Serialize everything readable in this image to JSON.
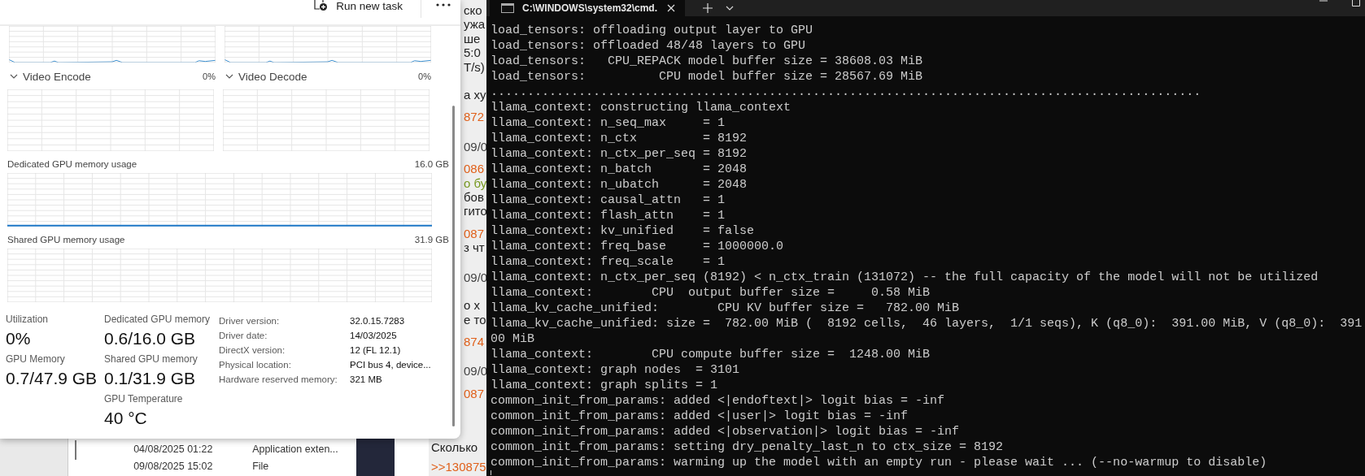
{
  "task_manager": {
    "toolbar": {
      "run_task": "Run new task"
    },
    "engine_graphs": [
      {
        "title": "Video Encode",
        "value": "0%"
      },
      {
        "title": "Video Decode",
        "value": "0%"
      }
    ],
    "memory_graphs": [
      {
        "title": "Dedicated GPU memory usage",
        "max": "16.0 GB",
        "kind": "line"
      },
      {
        "title": "Shared GPU memory usage",
        "max": "31.9 GB",
        "kind": "empty"
      }
    ],
    "stat_columns": [
      [
        {
          "label": "Utilization",
          "value": "0%"
        },
        {
          "label": "GPU Memory",
          "value": "0.7/47.9 GB"
        }
      ],
      [
        {
          "label": "Dedicated GPU memory",
          "value": "0.6/16.0 GB"
        },
        {
          "label": "Shared GPU memory",
          "value": "0.1/31.9 GB"
        },
        {
          "label": "GPU Temperature",
          "value": "40 °C"
        }
      ]
    ],
    "details": [
      {
        "label": "Driver version:",
        "value": "32.0.15.7283"
      },
      {
        "label": "Driver date:",
        "value": "14/03/2025"
      },
      {
        "label": "DirectX version:",
        "value": "12 (FL 12.1)"
      },
      {
        "label": "Physical location:",
        "value": "PCI bus 4, device..."
      },
      {
        "label": "Hardware reserved memory:",
        "value": "321 MB"
      }
    ]
  },
  "background_page": {
    "fragments": [
      {
        "text": "ско",
        "kind": "text"
      },
      {
        "text": "ужа",
        "kind": "text"
      },
      {
        "text": "ше",
        "kind": "text"
      },
      {
        "text": "5:0",
        "kind": "text"
      },
      {
        "text": "T/s)",
        "kind": "text"
      },
      {
        "text": "а ху",
        "kind": "gap"
      },
      {
        "text": "872",
        "kind": "link"
      },
      {
        "text": "09/0",
        "kind": "date"
      },
      {
        "text": "086",
        "kind": "link"
      },
      {
        "text": "о бу",
        "kind": "quote"
      },
      {
        "text": "бов",
        "kind": "text"
      },
      {
        "text": "гито",
        "kind": "text"
      },
      {
        "text": "087",
        "kind": "link"
      },
      {
        "text": "з чт",
        "kind": "text"
      },
      {
        "text": "09/0",
        "kind": "date"
      },
      {
        "text": "о х",
        "kind": "gap"
      },
      {
        "text": "е то",
        "kind": "text"
      },
      {
        "text": "874",
        "kind": "link"
      },
      {
        "text": "09/0",
        "kind": "date"
      },
      {
        "text": "087",
        "kind": "link"
      }
    ],
    "bottom_lines": [
      {
        "text": "Сколько",
        "kind": "text"
      },
      {
        "text": ">>130875",
        "kind": "link"
      }
    ]
  },
  "file_rows": [
    {
      "date": "04/08/2025 01:22",
      "type": "Application exten..."
    },
    {
      "date": "09/08/2025 15:02",
      "type": "File"
    }
  ],
  "terminal": {
    "tab_title": "C:\\WINDOWS\\system32\\cmd.",
    "lines": [
      "load_tensors: offloading output layer to GPU",
      "load_tensors: offloaded 48/48 layers to GPU",
      "load_tensors:   CPU_REPACK model buffer size = 38608.03 MiB",
      "load_tensors:          CPU model buffer size = 28567.69 MiB",
      ".................................................................................................",
      "llama_context: constructing llama_context",
      "llama_context: n_seq_max     = 1",
      "llama_context: n_ctx         = 8192",
      "llama_context: n_ctx_per_seq = 8192",
      "llama_context: n_batch       = 2048",
      "llama_context: n_ubatch      = 2048",
      "llama_context: causal_attn   = 1",
      "llama_context: flash_attn    = 1",
      "llama_context: kv_unified    = false",
      "llama_context: freq_base     = 1000000.0",
      "llama_context: freq_scale    = 1",
      "llama_context: n_ctx_per_seq (8192) < n_ctx_train (131072) -- the full capacity of the model will not be utilized",
      "llama_context:        CPU  output buffer size =     0.58 MiB",
      "llama_kv_cache_unified:        CPU KV buffer size =   782.00 MiB",
      "llama_kv_cache_unified: size =  782.00 MiB (  8192 cells,  46 layers,  1/1 seqs), K (q8_0):  391.00 MiB, V (q8_0):  391",
      "00 MiB",
      "llama_context:        CPU compute buffer size =  1248.00 MiB",
      "llama_context: graph nodes  = 3101",
      "llama_context: graph splits = 1",
      "common_init_from_params: added <|endoftext|> logit bias = -inf",
      "common_init_from_params: added <|user|> logit bias = -inf",
      "common_init_from_params: added <|observation|> logit bias = -inf",
      "common_init_from_params: setting dry_penalty_last_n to ctx_size = 8192",
      "common_init_from_params: warming up the model with an empty run - please wait ... (--no-warmup to disable)"
    ]
  }
}
